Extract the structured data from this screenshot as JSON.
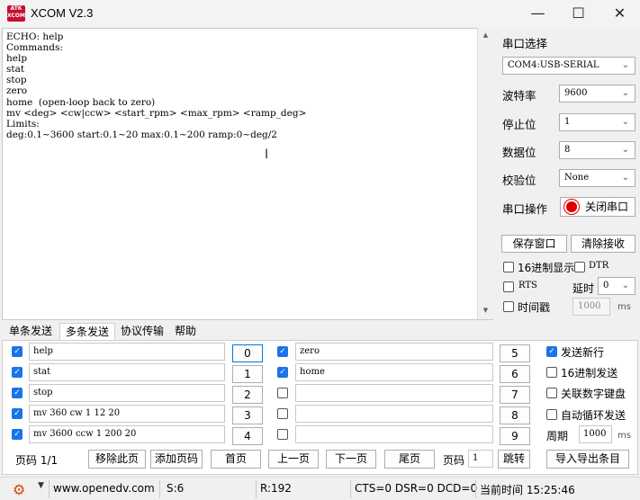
{
  "window": {
    "title": "XCOM V2.3",
    "logo_text": "ATK XCOM"
  },
  "terminal": {
    "lines": [
      "ECHO: help",
      "Commands:",
      "help",
      "stat",
      "stop",
      "zero",
      "home  (open-loop back to zero)",
      "mv <deg> <cw|ccw> <start_rpm> <max_rpm> <ramp_deg>",
      "Limits:",
      "deg:0.1~3600 start:0.1~20 max:0.1~200 ramp:0~deg/2"
    ]
  },
  "serial": {
    "port_select_label": "串口选择",
    "port_value": "COM4:USB-SERIAL",
    "baud_label": "波特率",
    "baud_value": "9600",
    "stopbits_label": "停止位",
    "stopbits_value": "1",
    "databits_label": "数据位",
    "databits_value": "8",
    "parity_label": "校验位",
    "parity_value": "None",
    "op_label": "串口操作",
    "close_port_label": "关闭串口",
    "save_window_label": "保存窗口",
    "clear_recv_label": "清除接收",
    "hex_display_label": "16进制显示",
    "dtr_label": "DTR",
    "rts_label": "RTS",
    "delay_label": "延时",
    "delay_value": "0",
    "timestamp_label": "时间戳",
    "timestamp_value": "1000",
    "ms_label": "ms"
  },
  "tabs": [
    "单条发送",
    "多条发送",
    "协议传输",
    "帮助"
  ],
  "multi_send": {
    "left": [
      {
        "text": "help",
        "checked": true,
        "num": "0"
      },
      {
        "text": "stat",
        "checked": true,
        "num": "1"
      },
      {
        "text": "stop",
        "checked": true,
        "num": "2"
      },
      {
        "text": "mv 360 cw 1 12 20",
        "checked": true,
        "num": "3"
      },
      {
        "text": "mv 3600 ccw 1 200 20",
        "checked": true,
        "num": "4"
      }
    ],
    "right": [
      {
        "text": "zero",
        "checked": true,
        "num": "5"
      },
      {
        "text": "home",
        "checked": true,
        "num": "6"
      },
      {
        "text": "",
        "checked": false,
        "num": "7"
      },
      {
        "text": "",
        "checked": false,
        "num": "8"
      },
      {
        "text": "",
        "checked": false,
        "num": "9"
      }
    ],
    "send_newline_label": "发送新行",
    "hex_send_label": "16进制发送",
    "link_keyboard_label": "关联数字键盘",
    "auto_loop_label": "自动循环发送",
    "period_label": "周期",
    "period_value": "1000",
    "ms_label": "ms",
    "page_code_label": "页码 1/1",
    "remove_page_label": "移除此页",
    "add_page_label": "添加页码",
    "first_label": "首页",
    "prev_label": "上一页",
    "next_label": "下一页",
    "last_label": "尾页",
    "page_label": "页码",
    "page_value": "1",
    "jump_label": "跳转",
    "import_export_label": "导入导出条目"
  },
  "statusbar": {
    "url": "www.openedv.com",
    "sent": "S:6",
    "recv": "R:192",
    "signals": "CTS=0 DSR=0 DCD=0",
    "time": "当前时间 15:25:46"
  },
  "colors": {
    "accent": "#1a73e8",
    "record_red": "#e00000"
  }
}
